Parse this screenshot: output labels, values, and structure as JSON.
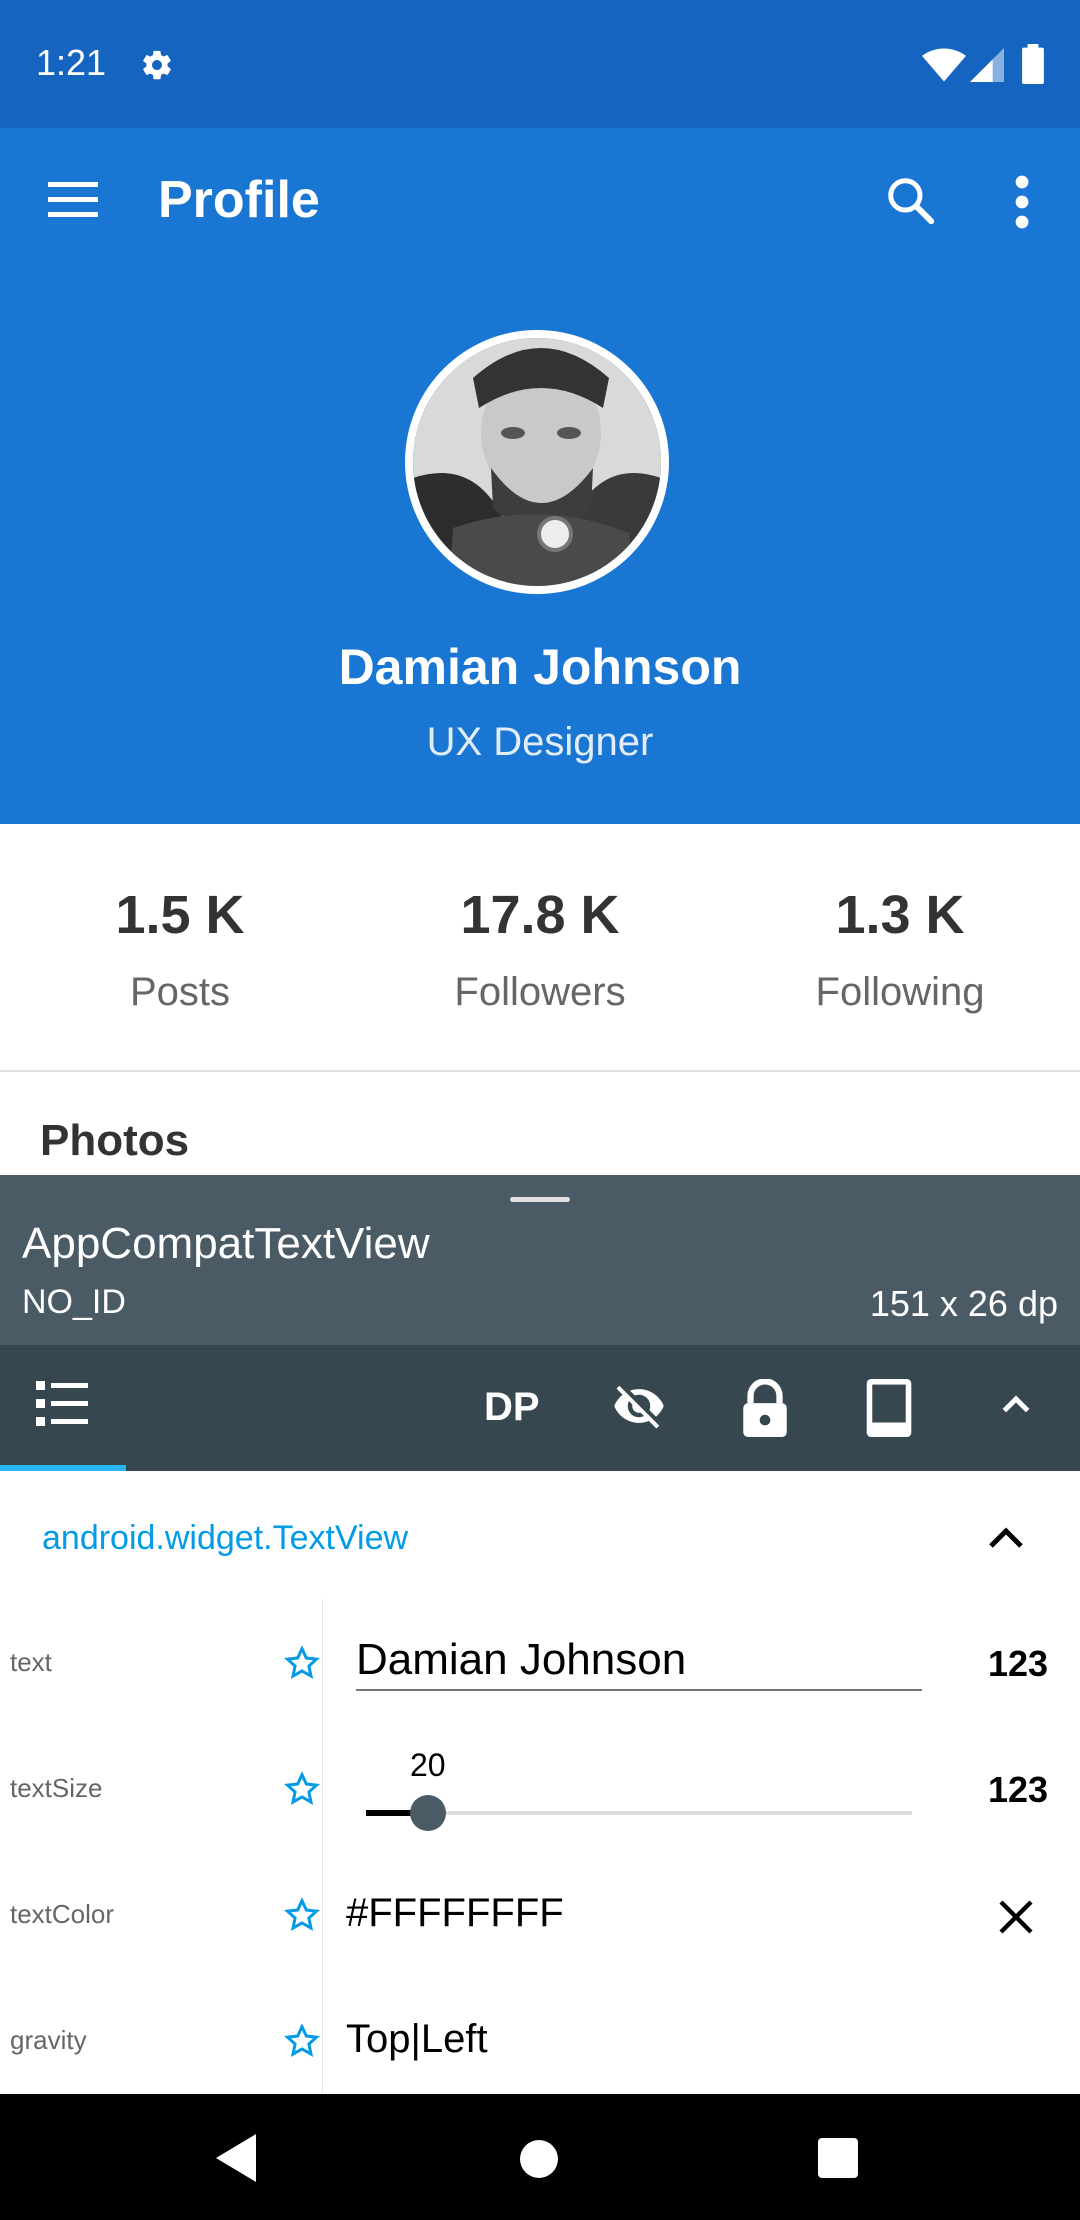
{
  "status_bar": {
    "time": "1:21"
  },
  "app_bar": {
    "title": "Profile"
  },
  "profile": {
    "name": "Damian Johnson",
    "role": "UX Designer"
  },
  "stats": [
    {
      "value": "1.5 K",
      "label": "Posts"
    },
    {
      "value": "17.8 K",
      "label": "Followers"
    },
    {
      "value": "1.3 K",
      "label": "Following"
    }
  ],
  "section": {
    "photos_title": "Photos"
  },
  "inspector": {
    "class_name": "AppCompatTextView",
    "id": "NO_ID",
    "size": "151 x 26 dp",
    "toolbar": {
      "dp_label": "DP"
    },
    "package": "android.widget.TextView",
    "properties": {
      "text": {
        "key": "text",
        "value": "Damian Johnson",
        "action": "123"
      },
      "textSize": {
        "key": "textSize",
        "value": "20",
        "action": "123"
      },
      "textColor": {
        "key": "textColor",
        "value": "#FFFFFFFF"
      },
      "gravity": {
        "key": "gravity",
        "value": "Top|Left"
      }
    }
  },
  "colors": {
    "status_bar": "#1565c0",
    "primary": "#1976d2",
    "inspector_header": "#4b5b66",
    "inspector_toolbar": "#37474f",
    "accent": "#039be5"
  },
  "icons": [
    "settings-icon",
    "wifi-icon",
    "signal-icon",
    "battery-icon",
    "menu-icon",
    "search-icon",
    "more-vert-icon",
    "list-icon",
    "eye-off-icon",
    "lock-icon",
    "tablet-icon",
    "chevron-up-icon",
    "star-icon",
    "close-icon",
    "back-icon",
    "home-icon",
    "recents-icon"
  ]
}
